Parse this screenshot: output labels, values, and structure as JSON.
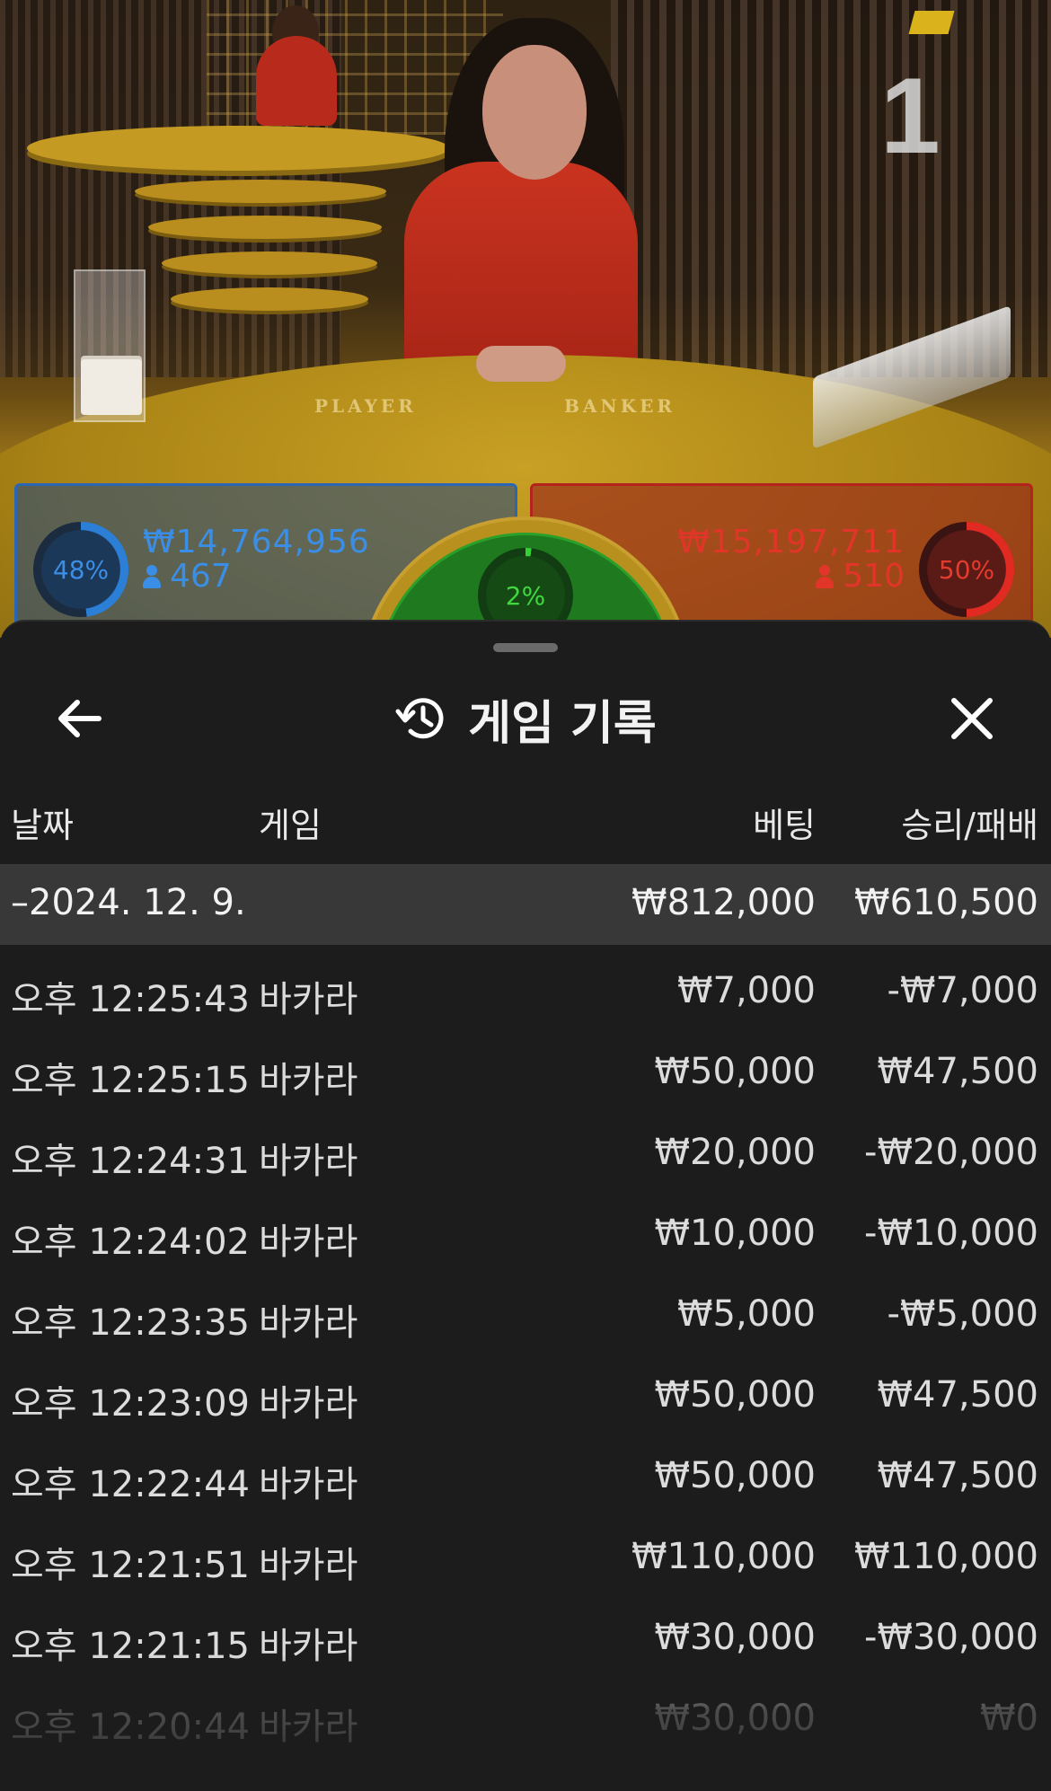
{
  "video": {
    "round_number": "1",
    "felt_labels": {
      "player": "PLAYER",
      "banker": "BANKER"
    }
  },
  "bets": {
    "player": {
      "percent": "48%",
      "amount": "₩14,764,956",
      "players": "467",
      "percent_value": 48,
      "color": "#2c7fd6"
    },
    "tie": {
      "percent": "2%",
      "percent_value": 2,
      "color": "#34d034"
    },
    "banker": {
      "percent": "50%",
      "amount": "₩15,197,711",
      "players": "510",
      "percent_value": 50,
      "color": "#e02a22"
    }
  },
  "sheet": {
    "title": "게임 기록",
    "icons": {
      "back": "arrow-left-icon",
      "history": "history-icon",
      "close": "close-icon"
    },
    "columns": {
      "date": "날짜",
      "game": "게임",
      "bet": "베팅",
      "result": "승리/패배"
    },
    "group": {
      "date": "–2024. 12. 9.",
      "bet": "₩812,000",
      "result": "₩610,500"
    },
    "rows": [
      {
        "time": "오후 12:25:43",
        "game": "바카라",
        "bet": "₩7,000",
        "result": "-₩7,000"
      },
      {
        "time": "오후 12:25:15",
        "game": "바카라",
        "bet": "₩50,000",
        "result": "₩47,500"
      },
      {
        "time": "오후 12:24:31",
        "game": "바카라",
        "bet": "₩20,000",
        "result": "-₩20,000"
      },
      {
        "time": "오후 12:24:02",
        "game": "바카라",
        "bet": "₩10,000",
        "result": "-₩10,000"
      },
      {
        "time": "오후 12:23:35",
        "game": "바카라",
        "bet": "₩5,000",
        "result": "-₩5,000"
      },
      {
        "time": "오후 12:23:09",
        "game": "바카라",
        "bet": "₩50,000",
        "result": "₩47,500"
      },
      {
        "time": "오후 12:22:44",
        "game": "바카라",
        "bet": "₩50,000",
        "result": "₩47,500"
      },
      {
        "time": "오후 12:21:51",
        "game": "바카라",
        "bet": "₩110,000",
        "result": "₩110,000"
      },
      {
        "time": "오후 12:21:15",
        "game": "바카라",
        "bet": "₩30,000",
        "result": "-₩30,000"
      },
      {
        "time": "오후 12:20:44",
        "game": "바카라",
        "bet": "₩30,000",
        "result": "₩0"
      }
    ]
  }
}
